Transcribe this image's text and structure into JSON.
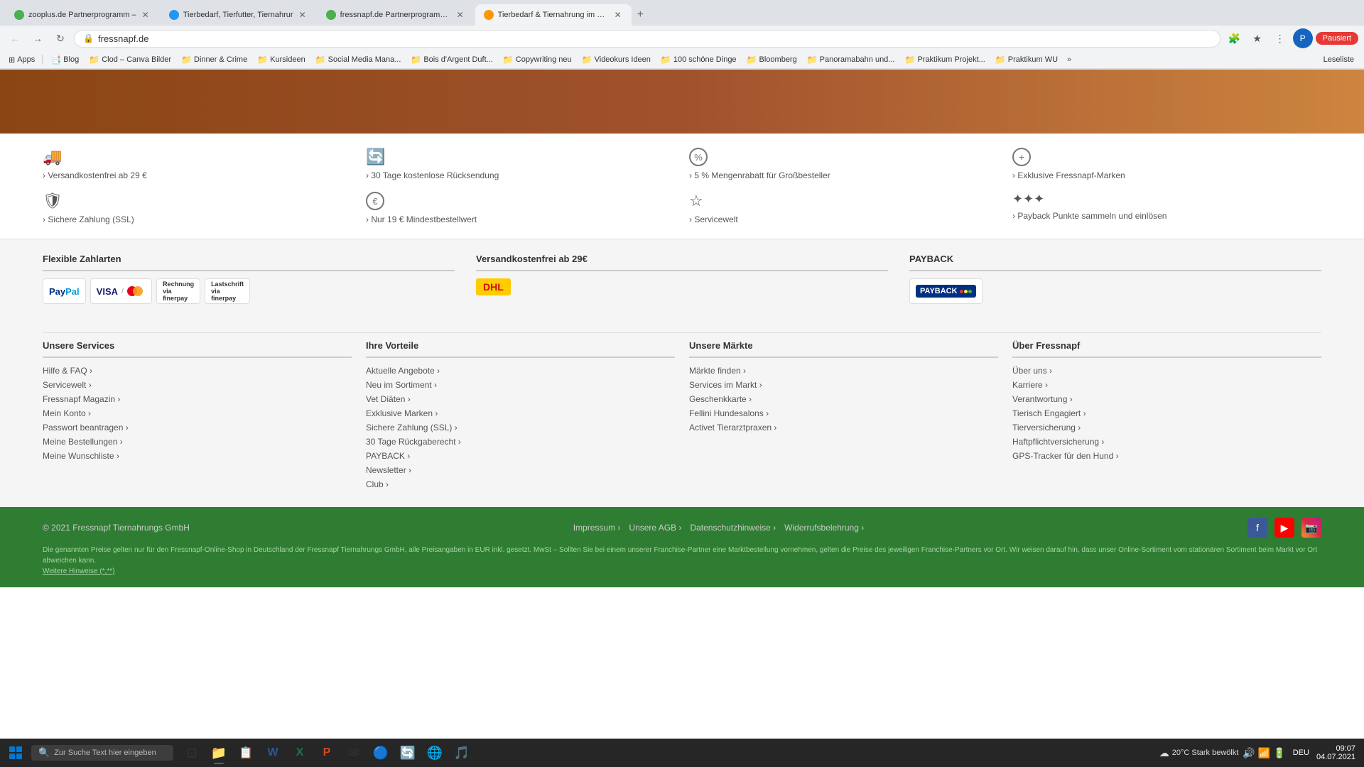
{
  "browser": {
    "tabs": [
      {
        "id": 1,
        "favicon_color": "green",
        "title": "zooplus.de Partnerprogramm –",
        "active": false
      },
      {
        "id": 2,
        "favicon_color": "blue",
        "title": "Tierbedarf, Tierfutter, Tiernahrur",
        "active": false
      },
      {
        "id": 3,
        "favicon_color": "green",
        "title": "fressnapf.de Partnerprogramm –",
        "active": false
      },
      {
        "id": 4,
        "favicon_color": "orange",
        "title": "Tierbedarf & Tiernahrung im On-",
        "active": true
      }
    ],
    "address": "fressnapf.de",
    "profile_initial": "P"
  },
  "bookmarks": [
    {
      "label": "Apps",
      "icon": "⊞"
    },
    {
      "label": "Blog",
      "icon": "📑"
    },
    {
      "label": "Clod – Canva Bilder",
      "icon": "📁"
    },
    {
      "label": "Dinner & Crime",
      "icon": "📁"
    },
    {
      "label": "Kursideen",
      "icon": "📁"
    },
    {
      "label": "Social Media Mana...",
      "icon": "📁"
    },
    {
      "label": "Bois d'Argent Duft...",
      "icon": "📁"
    },
    {
      "label": "Copywriting neu",
      "icon": "📁"
    },
    {
      "label": "Videokurs Ideen",
      "icon": "📁"
    },
    {
      "label": "100 schöne Dinge",
      "icon": "📁"
    },
    {
      "label": "Bloomberg",
      "icon": "📁"
    },
    {
      "label": "Panoramabahn und...",
      "icon": "📁"
    },
    {
      "label": "Praktikum Projekt...",
      "icon": "📁"
    },
    {
      "label": "Praktikum WU",
      "icon": "📁"
    }
  ],
  "benefits": [
    {
      "icon": "🚚",
      "text": "Versandkostenfrei ab 29 €"
    },
    {
      "icon": "🔄",
      "text": "30 Tage kostenlose Rücksendung"
    },
    {
      "icon": "%",
      "text": "5 % Mengenrabatt für Großbesteller"
    },
    {
      "icon": "+",
      "text": "Exklusive Fressnapf-Marken"
    },
    {
      "icon": "🛡",
      "text": "Sichere Zahlung (SSL)"
    },
    {
      "icon": "€",
      "text": "Nur 19 € Mindestbestellwert"
    },
    {
      "icon": "☆",
      "text": "Servicewelt"
    },
    {
      "icon": "⁜",
      "text": "Payback Punkte sammeln und einlösen"
    }
  ],
  "payment": {
    "section_title": "Flexible Zahlarten",
    "shipping_title": "Versandkostenfrei ab 29€",
    "payback_title": "PAYBACK"
  },
  "footer_nav": {
    "cols": [
      {
        "title": "Unsere Services",
        "items": [
          "Hilfe & FAQ",
          "Servicewelt",
          "Fressnapf Magazin",
          "Mein Konto",
          "Passwort beantragen",
          "Meine Bestellungen",
          "Meine Wunschliste"
        ]
      },
      {
        "title": "Ihre Vorteile",
        "items": [
          "Aktuelle Angebote",
          "Neu im Sortiment",
          "Vet Diäten",
          "Exklusive Marken",
          "Sichere Zahlung (SSL)",
          "30 Tage Rückgaberecht",
          "PAYBACK",
          "Newsletter",
          "Club"
        ]
      },
      {
        "title": "Unsere Märkte",
        "items": [
          "Märkte finden",
          "Services im Markt",
          "Geschenkkarte",
          "Fellini Hundesalons",
          "Activet Tierarztpraxen"
        ]
      },
      {
        "title": "Über Fressnapf",
        "items": [
          "Über uns",
          "Karriere",
          "Verantwortung",
          "Tierisch Engagiert",
          "Tierversicherung",
          "Haftpflichtversicherung",
          "GPS-Tracker für den Hund"
        ]
      }
    ]
  },
  "footer_bottom": {
    "copyright": "© 2021 Fressnapf Tiernahrungs GmbH",
    "links": [
      "Impressum",
      "Unsere AGB",
      "Datenschutzhinweise",
      "Widerrufsbelehrung"
    ],
    "disclaimer": "Die genannten Preise gelten nur für den Fressnapf-Online-Shop in Deutschland der Fressnapf Tiernahrungs GmbH, alle Preisangaben in EUR inkl. gesetzt. MwSt – Sollten Sie bei einem unserer Franchise-Partner eine Marktbestellung vornehmen, gelten die Preise des jeweiligen Franchise-Partners vor Ort. Wir weisen darauf hin, dass unser Online-Sortiment vom stationären Sortiment beim Markt vor Ort abweichen kann.",
    "more_link": "Weitere Hinweise (*,**)"
  },
  "taskbar": {
    "search_placeholder": "Zur Suche Text hier eingeben",
    "apps": [
      {
        "icon": "⊞",
        "name": "task-view"
      },
      {
        "icon": "📁",
        "name": "file-explorer",
        "active": true
      },
      {
        "icon": "📋",
        "name": "sticky-notes"
      },
      {
        "icon": "W",
        "name": "word"
      },
      {
        "icon": "X",
        "name": "excel"
      },
      {
        "icon": "P",
        "name": "powerpoint"
      },
      {
        "icon": "✉",
        "name": "mail"
      },
      {
        "icon": "🔵",
        "name": "app6"
      },
      {
        "icon": "🔄",
        "name": "app7"
      },
      {
        "icon": "🌐",
        "name": "edge"
      },
      {
        "icon": "🎵",
        "name": "spotify"
      }
    ],
    "weather": "20°C Stark bewölkt",
    "lang": "DEU",
    "time": "09:07",
    "date": "04.07.2021"
  }
}
